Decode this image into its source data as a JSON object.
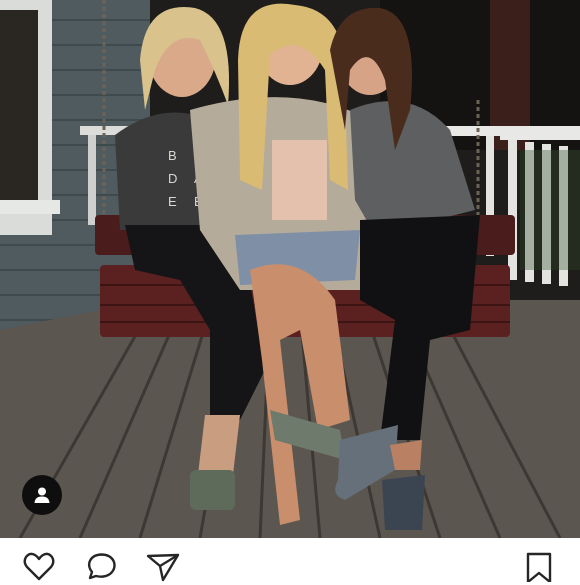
{
  "post": {
    "photo_icon": "porch-swing-photo",
    "tag_button_icon": "person-icon"
  },
  "action_bar": {
    "icons": [
      "heart-icon",
      "comment-icon",
      "share-icon",
      "bookmark-icon"
    ]
  },
  "colors": {
    "background": "#ffffff",
    "tag_button": "#0e0e0e",
    "icon_stroke": "#262626"
  }
}
